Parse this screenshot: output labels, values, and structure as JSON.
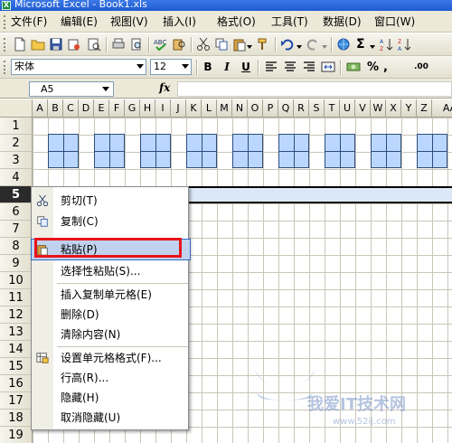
{
  "window": {
    "title": "Microsoft Excel - Book1.xls"
  },
  "menubar": {
    "items": [
      "文件(F)",
      "编辑(E)",
      "视图(V)",
      "插入(I)",
      "格式(O)",
      "工具(T)",
      "数据(D)",
      "窗口(W)"
    ]
  },
  "format_toolbar": {
    "font_name": "宋体",
    "font_size": "12",
    "bold": "B",
    "italic": "I",
    "underline": "U",
    "percent": "%",
    "increase_decimal": ".00",
    "comma": ","
  },
  "formula_bar": {
    "name_box": "A5",
    "fx": "fx"
  },
  "sheet": {
    "columns": [
      "A",
      "B",
      "C",
      "D",
      "E",
      "F",
      "G",
      "H",
      "I",
      "J",
      "K",
      "L",
      "M",
      "N",
      "O",
      "P",
      "Q",
      "R",
      "S",
      "T",
      "U",
      "V",
      "W",
      "X",
      "Y",
      "Z",
      "AA"
    ],
    "rows": [
      "1",
      "2",
      "3",
      "4",
      "5",
      "6",
      "7",
      "8",
      "9",
      "10",
      "11",
      "12",
      "13",
      "14",
      "15",
      "16",
      "17",
      "18",
      "19"
    ],
    "selected_row": "5"
  },
  "context_menu": {
    "items": [
      {
        "label": "剪切(T)",
        "icon": "scissors-icon"
      },
      {
        "label": "复制(C)",
        "icon": "copy-icon"
      },
      {
        "label": "粘贴(P)",
        "icon": "paste-icon"
      },
      {
        "label": "选择性粘贴(S)...",
        "icon": ""
      },
      {
        "label": "插入复制单元格(E)",
        "icon": ""
      },
      {
        "label": "删除(D)",
        "icon": ""
      },
      {
        "label": "清除内容(N)",
        "icon": ""
      },
      {
        "label": "设置单元格格式(F)...",
        "icon": "format-cells-icon"
      },
      {
        "label": "行高(R)...",
        "icon": ""
      },
      {
        "label": "隐藏(H)",
        "icon": ""
      },
      {
        "label": "取消隐藏(U)",
        "icon": ""
      }
    ],
    "highlighted": "粘贴(P)"
  },
  "watermark": {
    "text": "我爱IT技术网",
    "sub": "www.52ij.com"
  },
  "colors": {
    "highlight_box": "#e8141b",
    "shape_fill": "#bcd7ff",
    "title_bar": "#1f5bd1"
  }
}
